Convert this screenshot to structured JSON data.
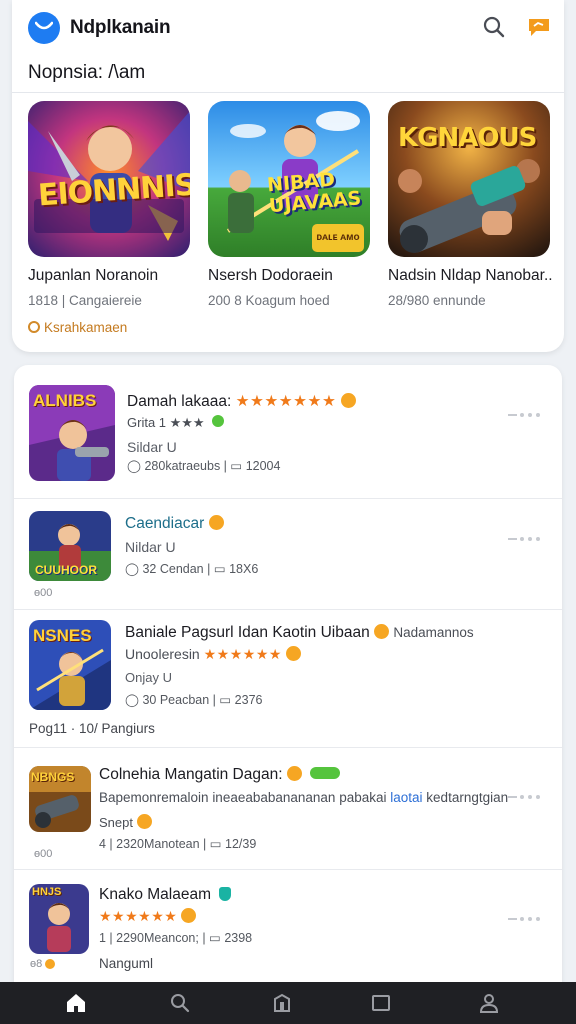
{
  "app": {
    "title": "Ndplkanain"
  },
  "section": {
    "title": "Nopnsia: /\\am"
  },
  "featured": [
    {
      "name": "Jupanlan Noranoin",
      "meta": "1818 | Cangaiereie",
      "banner": "EIONNNIS",
      "icon": "hero-fire-art",
      "accent": "#f0b62c"
    },
    {
      "name": "Nsersh Dodoraein",
      "meta": "200 8 Koagum hoed",
      "banner": "NIBAD UJAVAAS",
      "badge": "ᴅᴀʟᴇ ᴀᴍᴏ",
      "icon": "warrior-sword-art",
      "accent": "#f2d22c"
    },
    {
      "name": "Nadsin Nldap Nanobar..",
      "meta": "28/980 ennunde",
      "banner": "KGNAOUS",
      "icon": "cannon-art",
      "accent": "#f2c23a"
    }
  ],
  "featured_footer": "Ksrahkamaen",
  "list": [
    {
      "title": "Damah lakaaa:",
      "rating_line": "Grita 1 ★★★",
      "sub": "Sildar U",
      "meta": "◯ 280katraeubs | ▭ 12004",
      "icon_label": "ALNIBS"
    },
    {
      "title": "Caendiacar",
      "sub": "Nildar U",
      "meta": "◯ 32 Cendan | ▭ 18X6",
      "extra": "ɵ00",
      "icon_label": "CUUHOOR"
    },
    {
      "title": "Baniale Pagsurl Idan Kaotin Uibaan",
      "title_tail": "Nadamannos",
      "sub": "Unooleresin",
      "rating2": "Onjay U",
      "meta": "◯ 30 Peacban | ▭ 2376",
      "extra": "Pog11 · 10/ Pangiurs",
      "icon_label": "NSNES"
    },
    {
      "title": "Colnehia Mangatin Dagan:",
      "sub": "Bapemonremaloin ineaeababanananan pabakai",
      "sub_blue": "laotai",
      "sub_tail": "kedtarngtgian",
      "rating2": "Snept",
      "meta": "4 | 2320Manotean | ▭ 12/39",
      "extra": "ɵ00",
      "icon_label": "NBNGS"
    },
    {
      "title": "Knako Malaeam",
      "meta": "1 | 2290Meancon; | ▭ 2398",
      "extra_left": "ɵ8",
      "extra": "Nanguml",
      "icon_label": "HNJS"
    }
  ],
  "nav": [
    "home-icon",
    "search-icon",
    "apps-icon",
    "library-icon",
    "profile-icon"
  ],
  "colors": {
    "accent": "#1e7cf2",
    "star": "#f07a1a",
    "nav_bg": "#1f2024"
  }
}
